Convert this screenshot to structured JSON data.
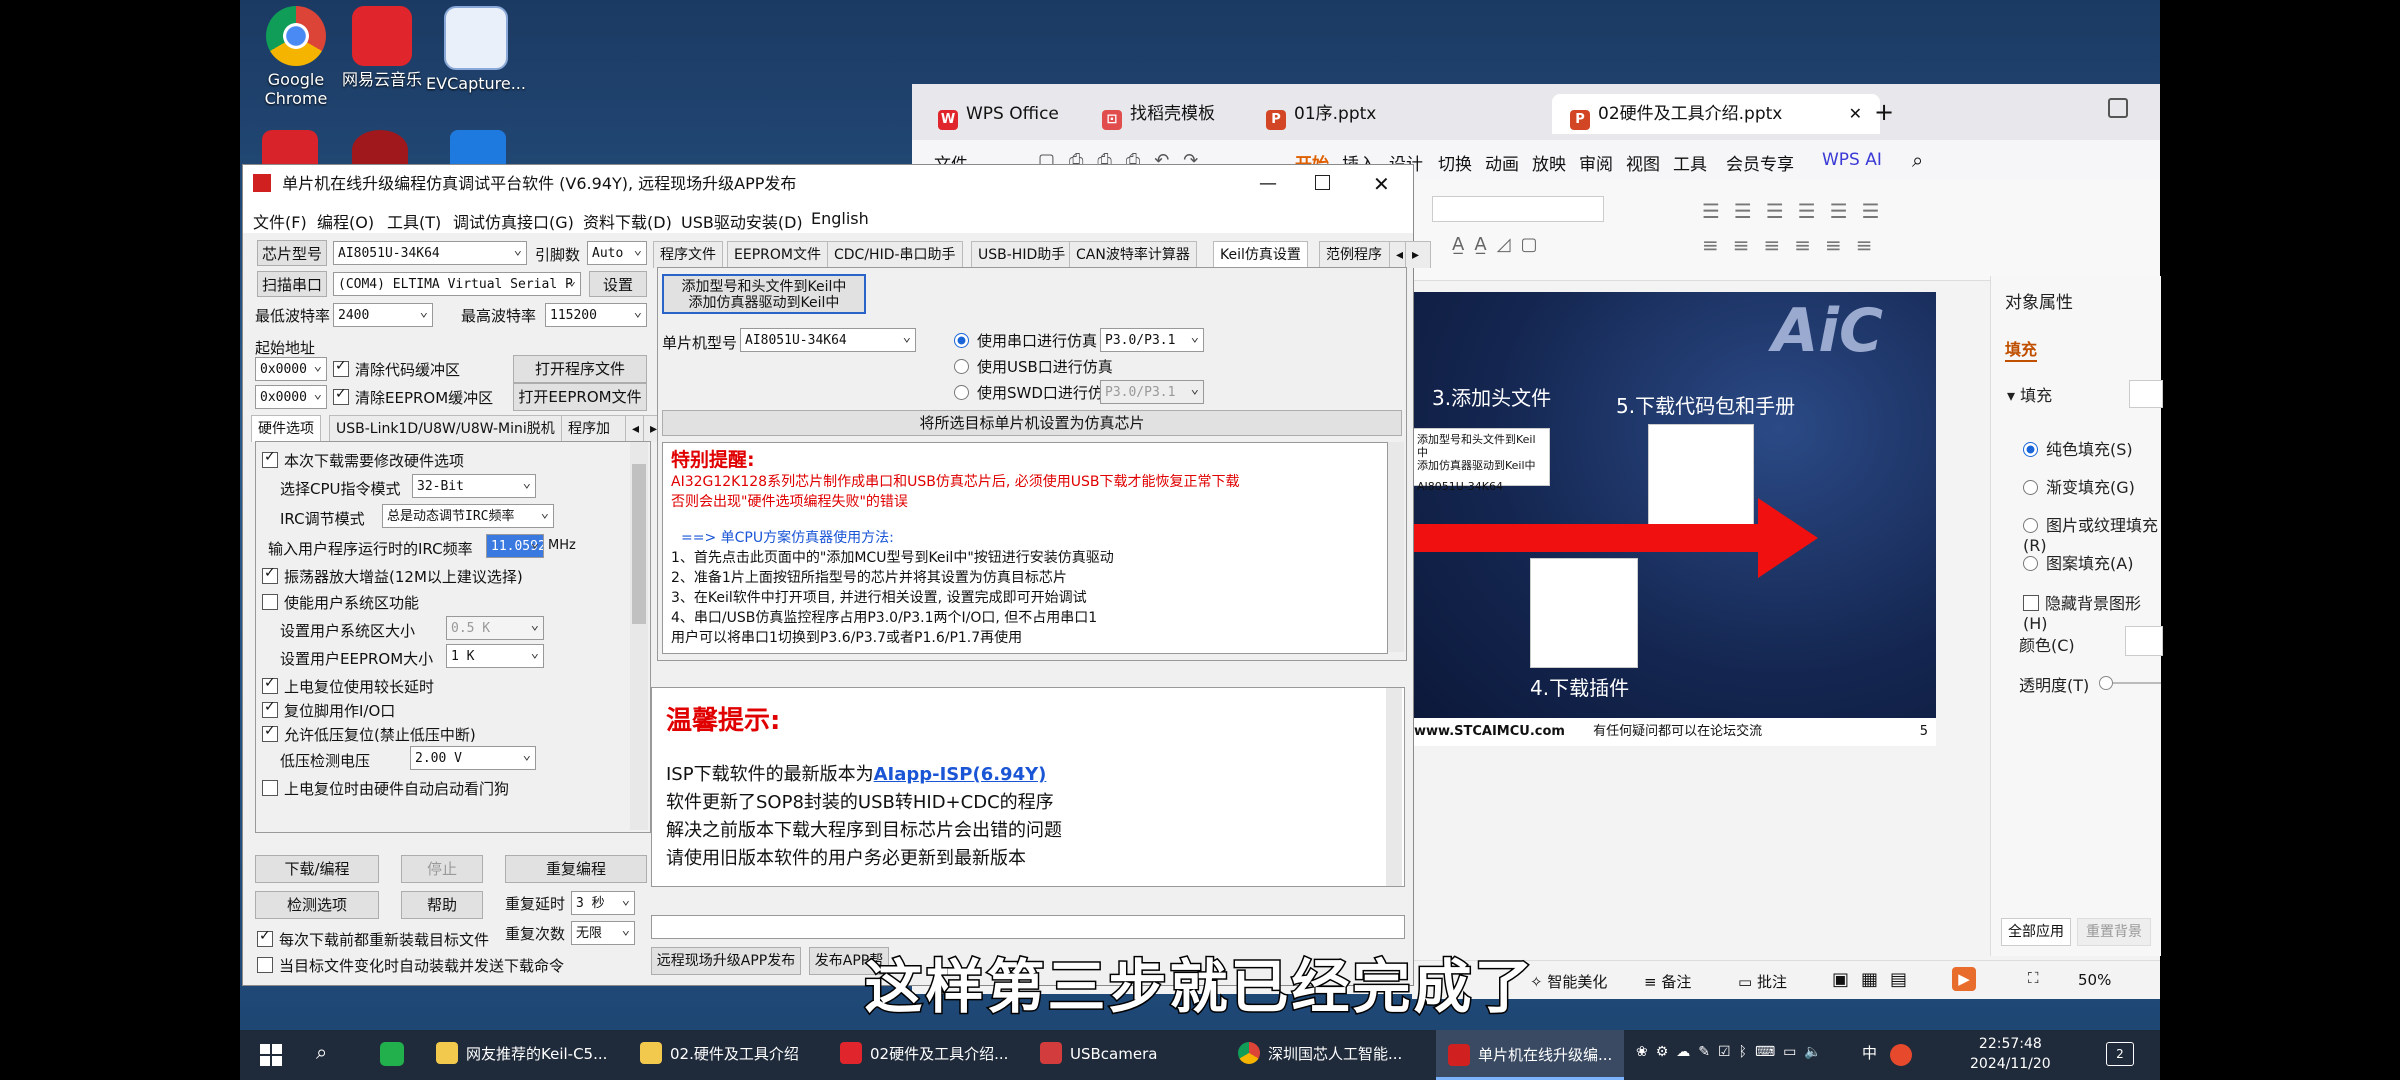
{
  "desktop": {
    "icons": [
      {
        "label1": "Google",
        "label2": "Chrome"
      },
      {
        "label1": "网易云音乐",
        "label2": ""
      },
      {
        "label1": "EVCapture...",
        "label2": ""
      }
    ]
  },
  "wps": {
    "tabs": [
      "WPS Office",
      "找稻壳模板",
      "01序.pptx",
      "02硬件及工具介绍.pptx"
    ],
    "new_tab": "+",
    "menu": [
      "文件",
      "开始",
      "插入",
      "设计",
      "切换",
      "动画",
      "放映",
      "审阅",
      "视图",
      "工具",
      "会员专享",
      "WPS AI"
    ],
    "slide": {
      "text_step3": "3.添加头文件",
      "text_step5": "5.下载代码包和手册",
      "text_step4": "4.下载插件",
      "logo": "AiC",
      "footer_url": "www.STCAIMCU.com",
      "footer_note": "有任何疑问都可以在论坛交流",
      "page_no": "5",
      "card_btn1": "添加型号和头文件到Keil中",
      "card_btn2": "添加仿真器驱动到Keil中",
      "card_model": "AI8051U-34K64"
    },
    "panel": {
      "title": "对象属性",
      "tab": "填充",
      "section": "填充",
      "options": [
        "纯色填充(S)",
        "渐变填充(G)",
        "图片或纹理填充(R)",
        "图案填充(A)"
      ],
      "hide_bg": "隐藏背景图形(H)",
      "color_label": "颜色(C)",
      "alpha_label": "透明度(T)",
      "apply_all": "全部应用",
      "reset_bg": "重置背景"
    },
    "status": {
      "smart": "智能美化",
      "notes": "备注",
      "comments": "批注",
      "zoom": "50%"
    }
  },
  "stc": {
    "title": "单片机在线升级编程仿真调试平台软件 (V6.94Y), 远程现场升级APP发布",
    "menu": [
      "文件(F)",
      "编程(O)",
      "工具(T)",
      "调试仿真接口(G)",
      "资料下载(D)",
      "USB驱动安装(D)",
      "English"
    ],
    "chip_label": "芯片型号",
    "chip_value": "AI8051U-34K64",
    "pins_label": "引脚数",
    "pins_value": "Auto",
    "scan_button": "扫描串口",
    "port_value": "(COM4) ELTIMA Virtual Serial P",
    "settings_button": "设置",
    "min_baud_label": "最低波特率",
    "min_baud_value": "2400",
    "max_baud_label": "最高波特率",
    "max_baud_value": "115200",
    "start_addr_label": "起始地址",
    "addr1": "0x0000",
    "clear_code": "清除代码缓冲区",
    "open_prog": "打开程序文件",
    "addr2": "0x0000",
    "clear_eeprom": "清除EEPROM缓冲区",
    "open_eeprom": "打开EEPROM文件",
    "left_tabs": [
      "硬件选项",
      "USB-Link1D/U8W/U8W-Mini脱机",
      "程序加"
    ],
    "hw": {
      "modify": "本次下载需要修改硬件选项",
      "cpu_mode_label": "选择CPU指令模式",
      "cpu_mode_value": "32-Bit",
      "irc_label": "IRC调节模式",
      "irc_value": "总是动态调节IRC频率",
      "irc_freq_label": "输入用户程序运行时的IRC频率",
      "irc_freq_value": "11.0592",
      "irc_unit": "MHz",
      "osc": "振荡器放大增益(12M以上建议选择)",
      "user_sys": "使能用户系统区功能",
      "sys_size_label": "设置用户系统区大小",
      "sys_size_value": "0.5 K",
      "eeprom_size_label": "设置用户EEPROM大小",
      "eeprom_size_value": "1   K",
      "power_on": "上电复位使用较长延时",
      "reset_io": "复位脚用作I/O口",
      "lvr": "允许低压复位(禁止低压中断)",
      "lvd_label": "低压检测电压",
      "lvd_value": "2.00 V",
      "wdt": "上电复位时由硬件自动启动看门狗"
    },
    "buttons": {
      "download": "下载/编程",
      "stop": "停止",
      "reprogram": "重复编程",
      "check": "检测选项",
      "help": "帮助"
    },
    "repeat_delay_label": "重复延时",
    "repeat_delay_value": "3 秒",
    "repeat_count_label": "重复次数",
    "repeat_count_value": "无限",
    "reload_each": "每次下载前都重新装载目标文件",
    "auto_load": "当目标文件变化时自动装载并发送下载命令",
    "right_tabs": [
      "程序文件",
      "EEPROM文件",
      "CDC/HID-串口助手",
      "USB-HID助手",
      "CAN波特率计算器",
      "Keil仿真设置",
      "范例程序"
    ],
    "keil": {
      "btn_add_model_1": "添加型号和头文件到Keil中",
      "btn_add_model_2": "添加仿真器驱动到Keil中",
      "mcu_label": "单片机型号",
      "mcu_value": "AI8051U-34K64",
      "opt_serial": "使用串口进行仿真",
      "opt_usb": "使用USB口进行仿真",
      "opt_swd": "使用SWD口进行仿真",
      "port_sel": "P3.0/P3.1",
      "port_sel2": "P3.0/P3.1",
      "set_chip": "将所选目标单片机设置为仿真芯片",
      "notice_title": "特别提醒:",
      "notice_l1": "AI32G12K128系列芯片制作成串口和USB仿真芯片后, 必须使用USB下载才能恢复正常下载",
      "notice_l2": "否则会出现\"硬件选项编程失败\"的错误",
      "method_title": "==> 单CPU方案仿真器使用方法:",
      "m1": "1、首先点击此页面中的\"添加MCU型号到Keil中\"按钮进行安装仿真驱动",
      "m2": "2、准备1片上面按钮所指型号的芯片并将其设置为仿真目标芯片",
      "m3": "3、在Keil软件中打开项目, 并进行相关设置, 设置完成即可开始调试",
      "m4": "4、串口/USB仿真监控程序占用P3.0/P3.1两个I/O口, 但不占用串口1",
      "m5": "   用户可以将串口1切换到P3.6/P3.7或者P1.6/P1.7再使用"
    },
    "tips": {
      "title": "温馨提示:",
      "l1_prefix": "ISP下载软件的最新版本为",
      "l1_link": "AIapp-ISP(6.94Y)",
      "l2": "软件更新了SOP8封装的USB转HID+CDC的程序",
      "l3": "解决之前版本下载大程序到目标芯片会出错的问题",
      "l4": "请使用旧版本软件的用户务必更新到最新版本"
    },
    "bottom_btn1": "远程现场升级APP发布",
    "bottom_btn2": "发布APP帮"
  },
  "subtitle": "这样第三步就已经完成了",
  "taskbar": {
    "items": [
      "网友推荐的Keil-C5...",
      "02.硬件及工具介绍",
      "02硬件及工具介绍...",
      "USBcamera",
      "深圳国芯人工智能...",
      "单片机在线升级编..."
    ],
    "ime": "中",
    "time": "22:57:48",
    "date": "2024/11/20",
    "notif": "2"
  }
}
